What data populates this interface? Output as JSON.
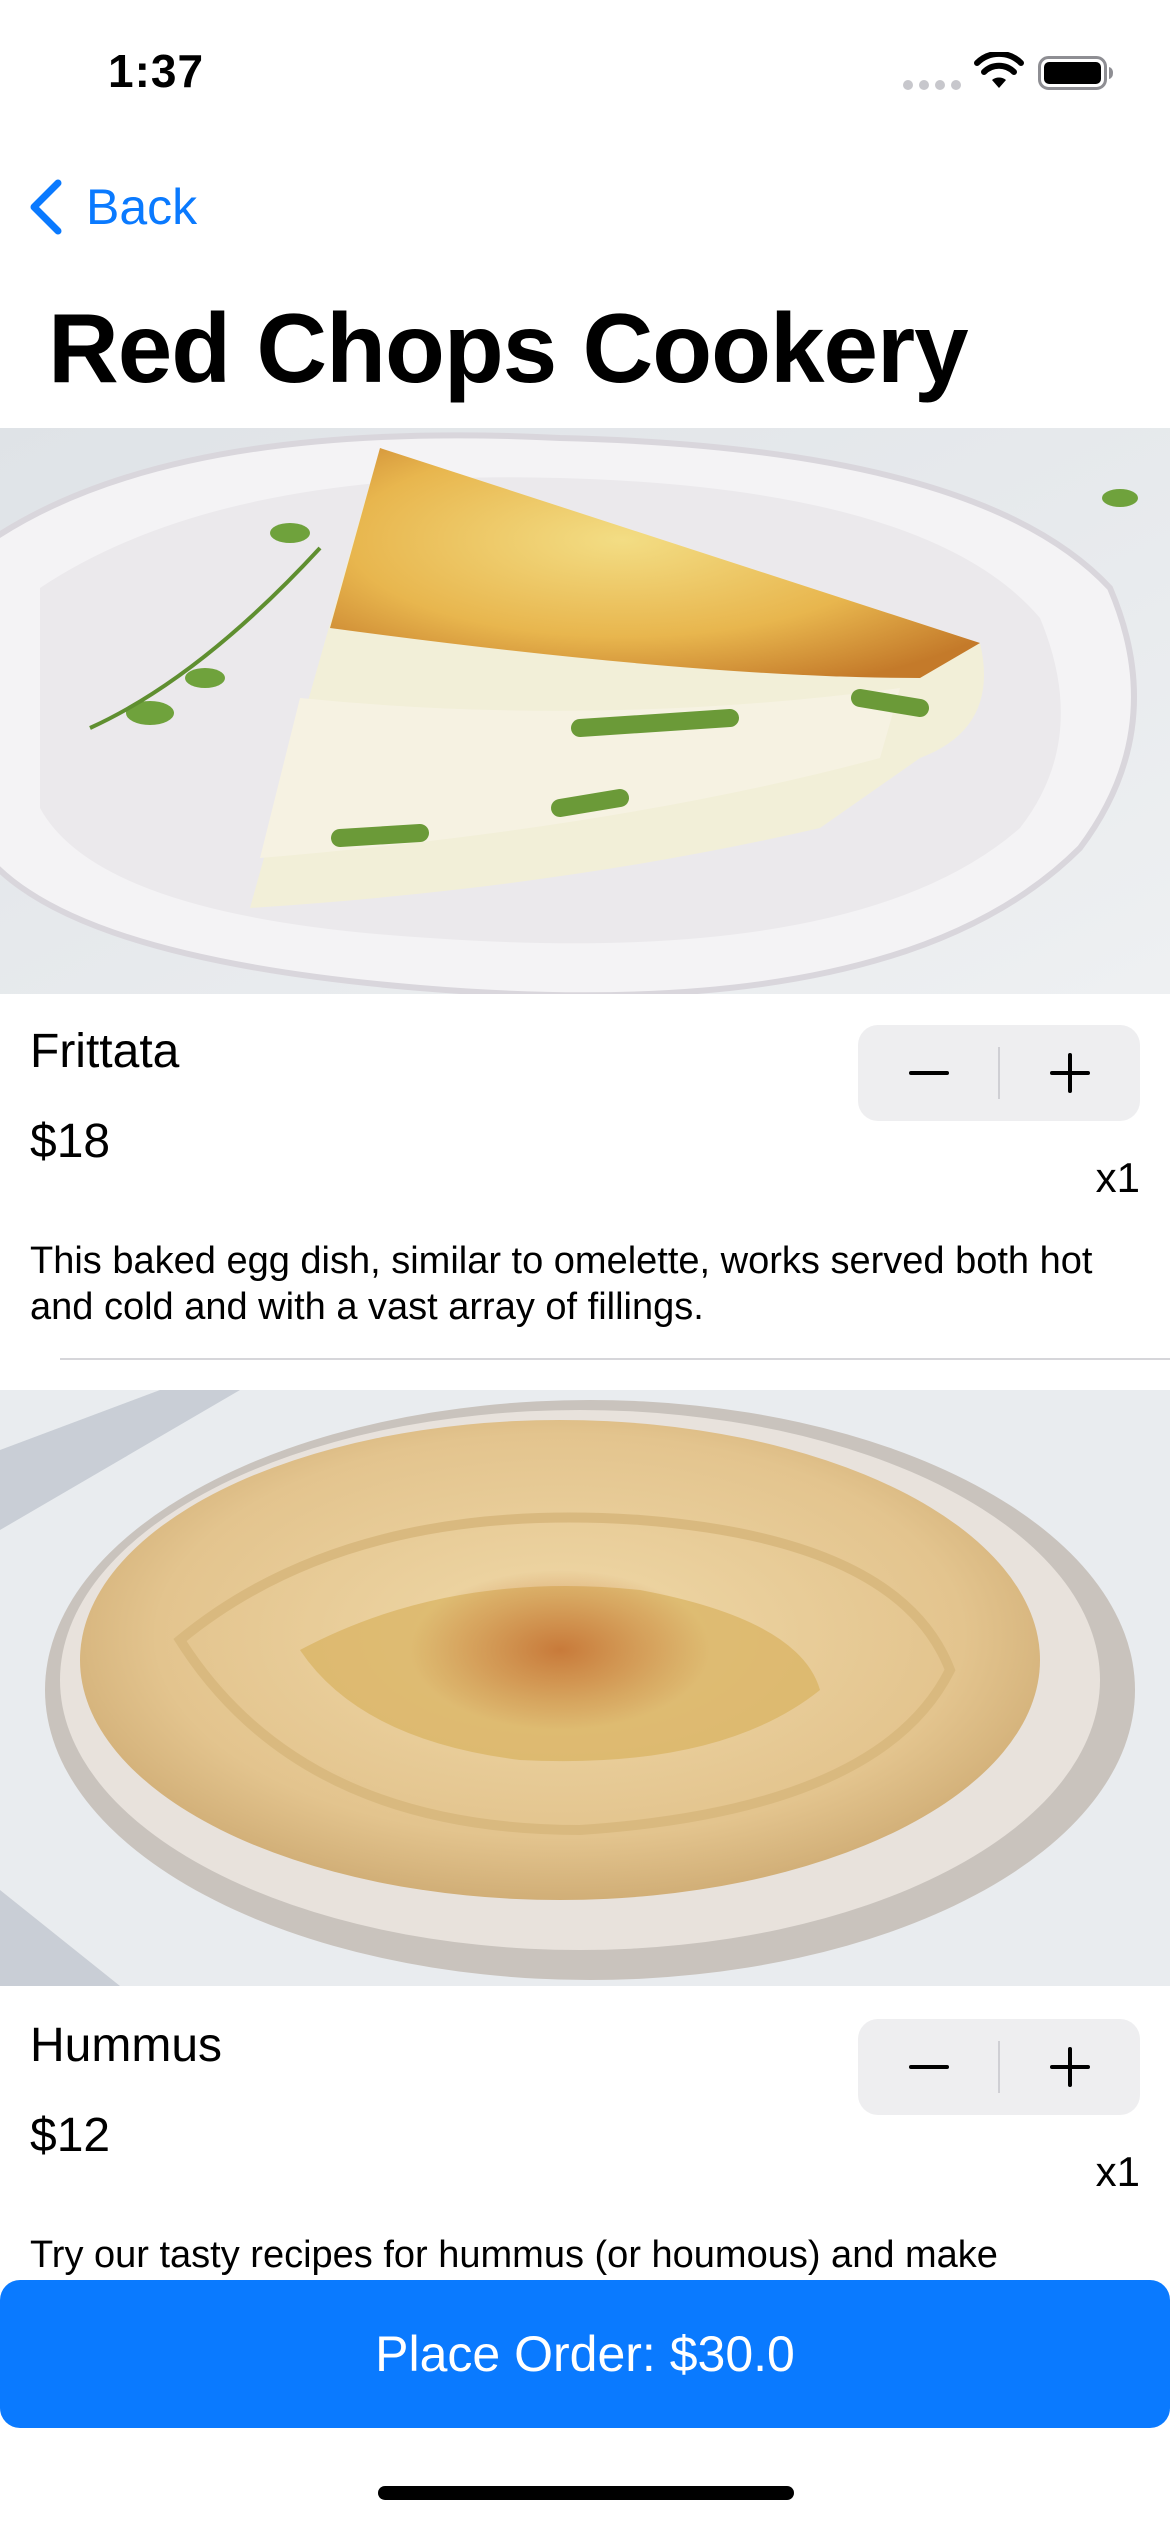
{
  "status_bar": {
    "time": "1:37",
    "icons": [
      "cellular-signal-icon",
      "wifi-icon",
      "battery-icon"
    ]
  },
  "nav": {
    "back_label": "Back",
    "back_icon": "chevron-left-icon",
    "title": "Red Chops Cookery"
  },
  "colors": {
    "accent": "#0a7aff",
    "stepper_bg": "#eeeef0",
    "separator": "#d6d6da"
  },
  "items": [
    {
      "name": "Frittata",
      "price": "$18",
      "quantity": "x1",
      "description": "This baked egg dish, similar to omelette, works served both hot and cold and with a vast array of fillings."
    },
    {
      "name": "Hummus",
      "price": "$12",
      "quantity": "x1",
      "description": "Try our tasty recipes for hummus (or houmous) and make"
    }
  ],
  "order_button": {
    "label": "Place Order: $30.0"
  }
}
